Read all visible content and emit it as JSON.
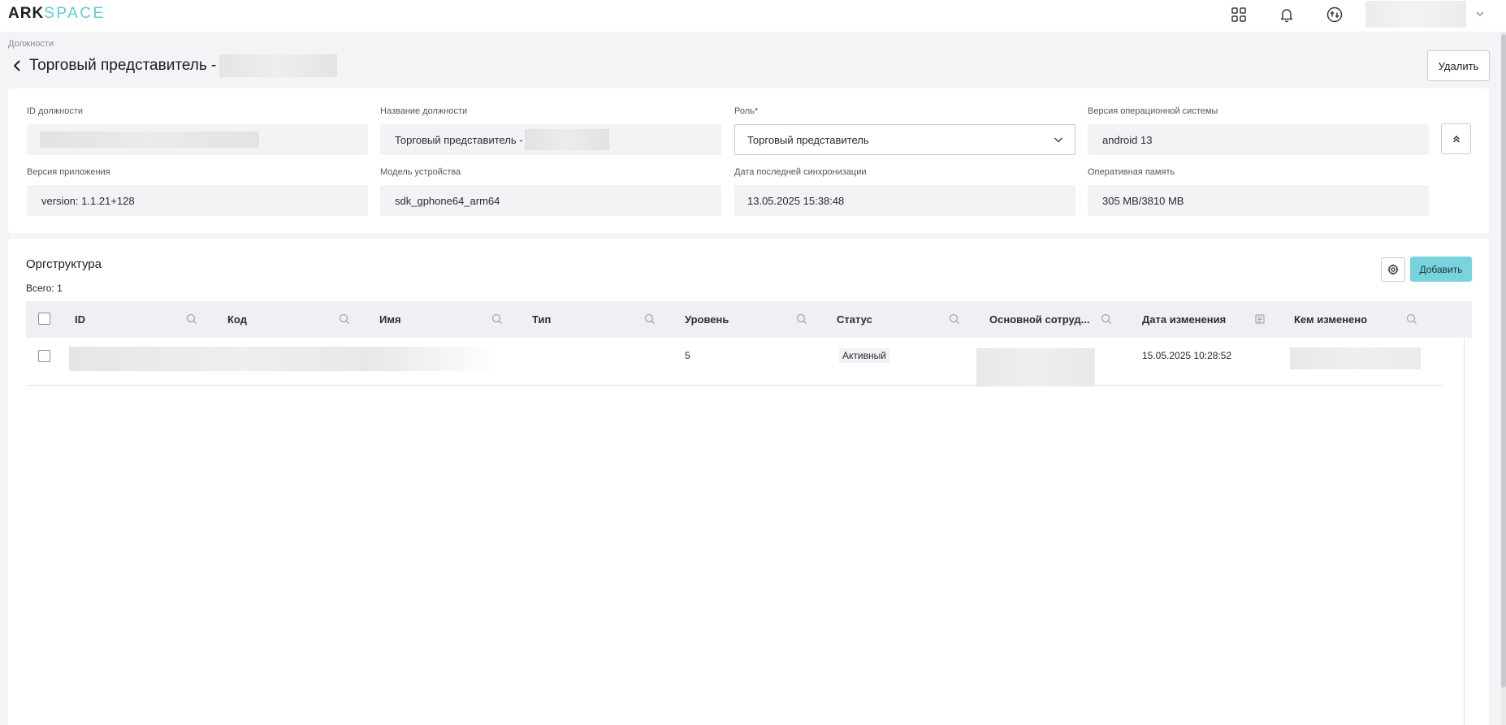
{
  "app": {
    "logo_part1": "ARK",
    "logo_part2": "SPACE"
  },
  "topbar": {
    "icons": [
      "apps-grid-icon",
      "bell-icon",
      "sync-icon"
    ],
    "user_menu_icon": "chevron-down-icon"
  },
  "breadcrumb": "Должности",
  "page": {
    "title": "Торговый представитель -",
    "delete_label": "Удалить"
  },
  "info": {
    "id_label": "ID должности",
    "name_label": "Название должности",
    "name_value": "Торговый представитель -",
    "role_label": "Роль*",
    "role_value": "Торговый представитель",
    "os_label": "Версия операционной системы",
    "os_value": "android 13",
    "app_version_label": "Версия приложения",
    "app_version_value": "version: 1.1.21+128",
    "device_label": "Модель устройства",
    "device_value": "sdk_gphone64_arm64",
    "sync_label": "Дата последней синхронизации",
    "sync_value": "13.05.2025 15:38:48",
    "ram_label": "Оперативная память",
    "ram_value": "305 MB/3810 MB"
  },
  "org": {
    "title": "Оргструктура",
    "total": "Всего: 1",
    "add_label": "Добавить",
    "columns": [
      "ID",
      "Код",
      "Имя",
      "Тип",
      "Уровень",
      "Статус",
      "Основной сотруд...",
      "Дата изменения",
      "Кем изменено"
    ],
    "rows": [
      {
        "level": "5",
        "status": "Активный",
        "changed_at": "15.05.2025 10:28:52"
      }
    ]
  },
  "colors": {
    "accent": "#79d3dc",
    "logo_dark": "#1c1c22",
    "logo_light": "#5fcbd6"
  }
}
